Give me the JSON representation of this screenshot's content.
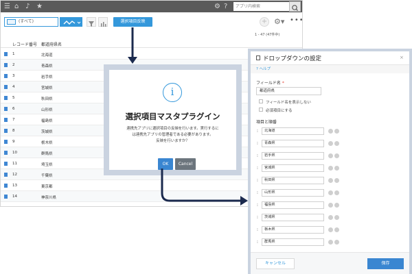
{
  "app": {
    "search_placeholder": "アプリ内検索",
    "view_selector": "(すべて)",
    "plugin_button": "選択項目反映",
    "pagination": "1 - 47 (47件中)",
    "table": {
      "columns": [
        "レコード番号",
        "都道府県名"
      ],
      "rows": [
        {
          "num": "1",
          "pref": "北海道"
        },
        {
          "num": "2",
          "pref": "青森県"
        },
        {
          "num": "3",
          "pref": "岩手県"
        },
        {
          "num": "4",
          "pref": "宮城県"
        },
        {
          "num": "5",
          "pref": "秋田県"
        },
        {
          "num": "6",
          "pref": "山形県"
        },
        {
          "num": "7",
          "pref": "福島県"
        },
        {
          "num": "8",
          "pref": "茨城県"
        },
        {
          "num": "9",
          "pref": "栃木県"
        },
        {
          "num": "10",
          "pref": "群馬県"
        },
        {
          "num": "11",
          "pref": "埼玉県"
        },
        {
          "num": "12",
          "pref": "千葉県"
        },
        {
          "num": "13",
          "pref": "東京都"
        },
        {
          "num": "14",
          "pref": "神奈川県"
        }
      ]
    }
  },
  "modal": {
    "icon": "i",
    "title": "選択項目マスタプラグイン",
    "body": [
      "連携先アプリに選択項目の反映を行います。実行するに",
      "は連携先アプリの管理者である必要があります。",
      "反映を行いますか？"
    ],
    "ok": "OK",
    "cancel": "Cancel"
  },
  "panel": {
    "title": "ドロップダウンの設定",
    "close": "×",
    "help": "? ヘルプ",
    "field_name_label": "フィールド名",
    "required_mark": "*",
    "field_name_value": "都道府県",
    "hide_field_name": "フィールド名を表示しない",
    "required_field": "必須項目にする",
    "options_label": "項目と順番",
    "options": [
      "北海道",
      "青森県",
      "岩手県",
      "宮城県",
      "秋田県",
      "山形県",
      "福島県",
      "茨城県",
      "栃木県",
      "群馬県"
    ],
    "cancel": "キャンセル",
    "save": "保存"
  },
  "colors": {
    "accent": "#3498db",
    "arrow": "#1b2a4e",
    "frame": "#cad3e0",
    "topbar": "#5a5a5a"
  }
}
